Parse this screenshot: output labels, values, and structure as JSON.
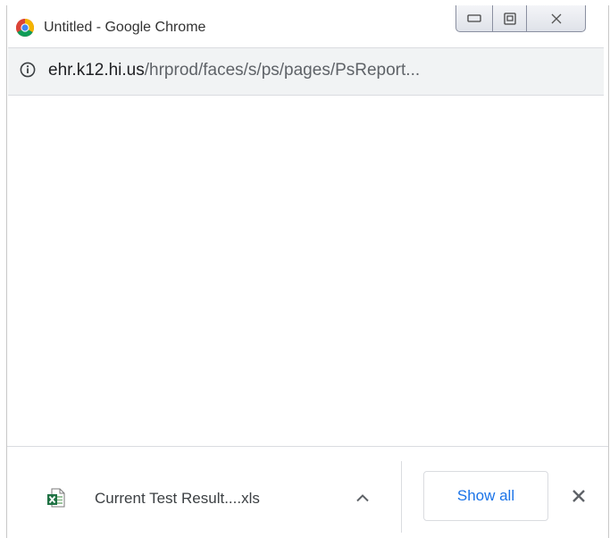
{
  "window": {
    "title": "Untitled - Google Chrome"
  },
  "addressbar": {
    "url_host": "ehr.k12.hi.us",
    "url_path": "/hrprod/faces/s/ps/pages/PsReport..."
  },
  "download": {
    "filename": "Current Test Result....xls",
    "file_icon": "excel-file-icon",
    "show_all_label": "Show all"
  },
  "colors": {
    "accent": "#1a73e8",
    "addressbar_bg": "#f1f3f4",
    "text": "#3c4043"
  }
}
